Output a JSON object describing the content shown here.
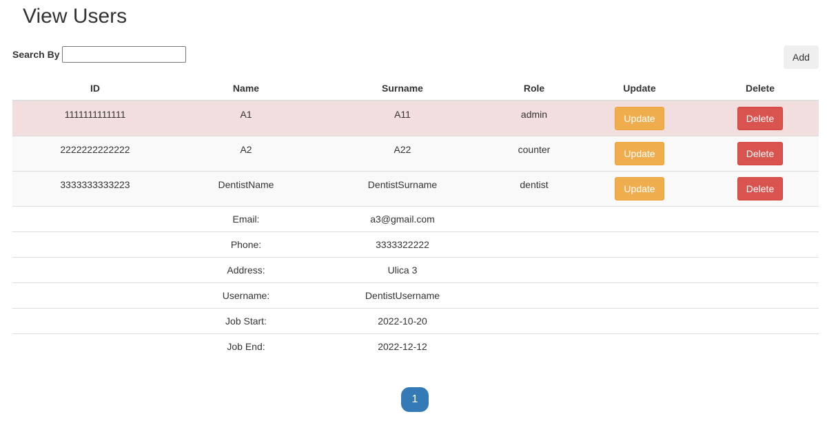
{
  "page": {
    "title": "View Users"
  },
  "search": {
    "label": "Search By",
    "value": "",
    "placeholder": ""
  },
  "toolbar": {
    "add_label": "Add"
  },
  "table": {
    "headers": {
      "id": "ID",
      "name": "Name",
      "surname": "Surname",
      "role": "Role",
      "update": "Update",
      "delete": "Delete"
    },
    "rows": [
      {
        "id": "1111111111111",
        "name": "A1",
        "surname": "A11",
        "role": "admin",
        "update_label": "Update",
        "delete_label": "Delete",
        "state": "selected"
      },
      {
        "id": "2222222222222",
        "name": "A2",
        "surname": "A22",
        "role": "counter",
        "update_label": "Update",
        "delete_label": "Delete",
        "state": "striped"
      },
      {
        "id": "3333333333223",
        "name": "DentistName",
        "surname": "DentistSurname",
        "role": "dentist",
        "update_label": "Update",
        "delete_label": "Delete",
        "state": "striped"
      }
    ],
    "details": [
      {
        "label": "Email:",
        "value": "a3@gmail.com"
      },
      {
        "label": "Phone:",
        "value": "3333322222"
      },
      {
        "label": "Address:",
        "value": "Ulica 3"
      },
      {
        "label": "Username:",
        "value": "DentistUsername"
      },
      {
        "label": "Job Start:",
        "value": "2022-10-20"
      },
      {
        "label": "Job End:",
        "value": "2022-12-12"
      }
    ]
  },
  "pagination": {
    "current_page": "1"
  },
  "colors": {
    "selected_row": "#f2dede",
    "update_button": "#f0ad4e",
    "delete_button": "#d9534f",
    "active_page": "#337ab7"
  }
}
